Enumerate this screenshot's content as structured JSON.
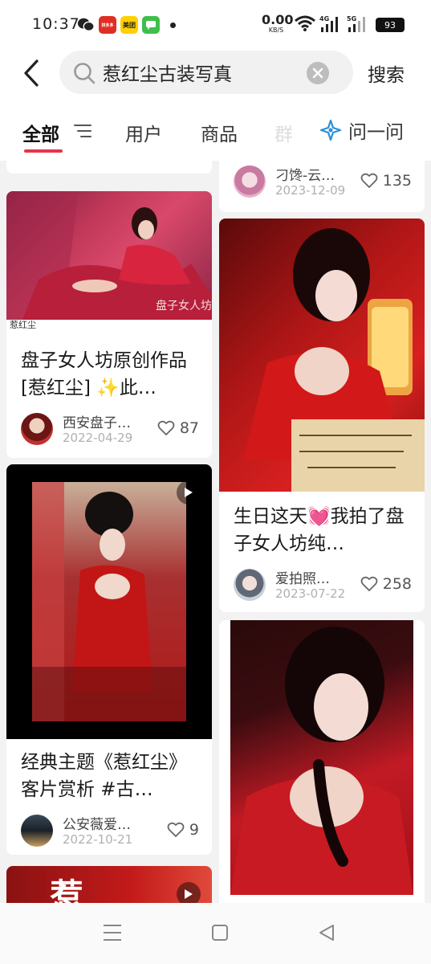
{
  "status_bar": {
    "time": "10:37",
    "app_badges": [
      "拼多多",
      "美团"
    ],
    "net_speed_value": "0.00",
    "net_speed_unit": "KB/S",
    "sim1": "4G",
    "sim2": "5G",
    "battery": "93"
  },
  "search": {
    "query": "惹红尘古装写真",
    "action_label": "搜索"
  },
  "tabs": {
    "items": [
      "全部",
      "用户",
      "商品",
      "群"
    ],
    "active": "全部",
    "ask_label": "问一问"
  },
  "feed": {
    "left": [
      {
        "title": "盘子女人坊原创作品[惹红尘] ✨此…",
        "caption": "惹红尘",
        "watermark": "盘子女人坊",
        "author": "西安盘子…",
        "date": "2022-04-29",
        "likes": "87"
      },
      {
        "title": "经典主题《惹红尘》客片赏析 #古…",
        "author": "公安薇爱…",
        "date": "2022-10-21",
        "likes": "9"
      },
      {
        "title": ""
      }
    ],
    "right": [
      {
        "author": "刁馋-云…",
        "date": "2023-12-09",
        "likes": "135"
      },
      {
        "title": "生日这天💓我拍了盘子女人坊纯…",
        "author": "爱拍照…",
        "date": "2023-07-22",
        "likes": "258"
      },
      {
        "title": ""
      }
    ]
  },
  "colors": {
    "accent": "#e8334a",
    "text_primary": "#1a1a1a",
    "text_muted": "#b0b0b0"
  },
  "icons": [
    "back-icon",
    "search-icon",
    "clear-icon",
    "filter-icon",
    "ai-star-icon",
    "heart-icon",
    "play-icon",
    "menu-icon",
    "home-icon",
    "back-triangle-icon"
  ]
}
